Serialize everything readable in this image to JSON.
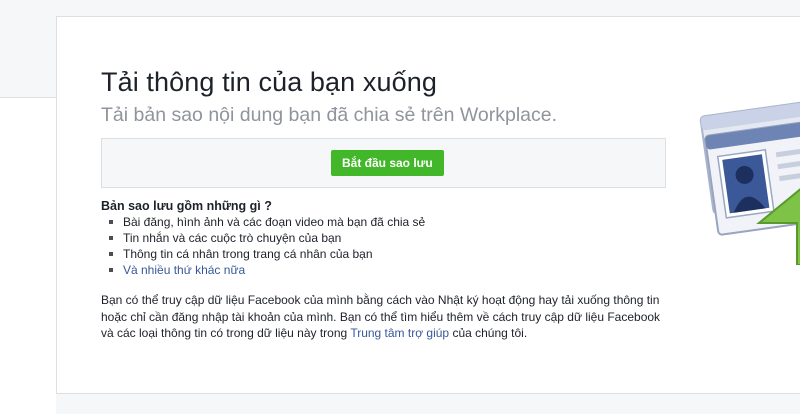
{
  "header": {
    "title": "Tải thông tin của bạn xuống",
    "subtitle": "Tải bản sao nội dung bạn đã chia sẻ trên Workplace."
  },
  "action": {
    "start_button": "Bắt đầu sao lưu"
  },
  "contents": {
    "heading": "Bản sao lưu gồm những gì ?",
    "items": [
      "Bài đăng, hình ảnh và các đoạn video mà bạn đã chia sẻ",
      "Tin nhắn và các cuộc trò chuyện của bạn",
      "Thông tin cá nhân trong trang cá nhân của bạn"
    ],
    "more_link": "Và nhiều thứ khác nữa"
  },
  "info": {
    "text_before_link": "Bạn có thể truy cập dữ liệu Facebook của mình bằng cách vào Nhật ký hoạt động hay tải xuống thông tin hoặc chỉ cần đăng nhập tài khoản của mình. Bạn có thể tìm hiểu thêm về cách truy cập dữ liệu Facebook và các loại thông tin có trong dữ liệu này trong ",
    "help_link": "Trung tâm trợ giúp",
    "text_after_link": " của chúng tôi."
  },
  "colors": {
    "primary_button": "#42b72a",
    "link": "#365899",
    "muted_text": "#90949c"
  },
  "icons": {
    "illustration": "download-profile-card-icon"
  }
}
